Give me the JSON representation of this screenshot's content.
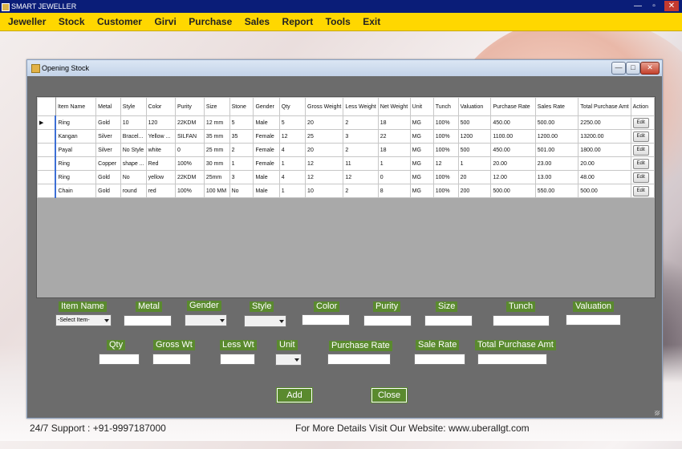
{
  "app": {
    "title": "SMART JEWELLER"
  },
  "title_buttons": {
    "minimize": "—",
    "maximize": "▫",
    "close": "✕"
  },
  "menu": [
    "Jeweller",
    "Stock",
    "Customer",
    "Girvi",
    "Purchase",
    "Sales",
    "Report",
    "Tools",
    "Exit"
  ],
  "window": {
    "title": "Opening Stock",
    "minimize": "—",
    "maximize": "□",
    "close": "✕"
  },
  "grid": {
    "headers": [
      "Item Name",
      "Metal",
      "Style",
      "Color",
      "Purity",
      "Size",
      "Stone",
      "Gender",
      "Qty",
      "Gross Weight",
      "Less Weight",
      "Net Weight",
      "Unit",
      "Tunch",
      "Valuation",
      "Purchase Rate",
      "Sales Rate",
      "Total Purchase Amt",
      "Action"
    ],
    "rows": [
      [
        "Ring",
        "Gold",
        "10",
        "120",
        "22KDM",
        "12 mm",
        "5",
        "Male",
        "5",
        "20",
        "2",
        "18",
        "MG",
        "100%",
        "500",
        "450.00",
        "500.00",
        "2250.00",
        "Edit"
      ],
      [
        "Kangan",
        "Silver",
        "Bracel...",
        "Yellow ...",
        "SILFAN",
        "35 mm",
        "35",
        "Female",
        "12",
        "25",
        "3",
        "22",
        "MG",
        "100%",
        "1200",
        "1100.00",
        "1200.00",
        "13200.00",
        "Edit"
      ],
      [
        "Payal",
        "Silver",
        "No Style",
        "white",
        "0",
        "25 mm",
        "2",
        "Female",
        "4",
        "20",
        "2",
        "18",
        "MG",
        "100%",
        "500",
        "450.00",
        "501.00",
        "1800.00",
        "Edit"
      ],
      [
        "Ring",
        "Copper",
        "shape ...",
        "Red",
        "100%",
        "30 mm",
        "1",
        "Female",
        "1",
        "12",
        "11",
        "1",
        "MG",
        "12",
        "1",
        "20.00",
        "23.00",
        "20.00",
        "Edit"
      ],
      [
        "Ring",
        "Gold",
        "No",
        "yellow",
        "22KDM",
        "25mm",
        "3",
        "Male",
        "4",
        "12",
        "12",
        "0",
        "MG",
        "100%",
        "20",
        "12.00",
        "13.00",
        "48.00",
        "Edit"
      ],
      [
        "Chain",
        "Gold",
        "round",
        "red",
        "100%",
        "100 MM",
        "No",
        "Male",
        "1",
        "10",
        "2",
        "8",
        "MG",
        "100%",
        "200",
        "500.00",
        "550.00",
        "500.00",
        "Edit"
      ]
    ],
    "current_row_marker": "▶"
  },
  "form": {
    "labels": {
      "item_name": "Item Name",
      "metal": "Metal",
      "gender": "Gender",
      "style": "Style",
      "color": "Color",
      "purity": "Purity",
      "size": "Size",
      "tunch": "Tunch",
      "valuation": "Valuation",
      "qty": "Qty",
      "gross_wt": "Gross Wt",
      "less_wt": "Less Wt",
      "unit": "Unit",
      "purchase_rate": "Purchase Rate",
      "sale_rate": "Sale Rate",
      "total_purchase_amt": "Total Purchase Amt"
    },
    "item_select_value": "-Select Item-",
    "buttons": {
      "add": "Add",
      "close": "Close"
    }
  },
  "footer": {
    "support": "24/7 Support : +91-9997187000",
    "website": "For More Details Visit Our Website: www.uberallgt.com"
  },
  "colors": {
    "menubar": "#ffd700",
    "titlebar": "#0a1d78",
    "label_green": "#5a8a2e",
    "form_bg": "#6c6c6c"
  }
}
